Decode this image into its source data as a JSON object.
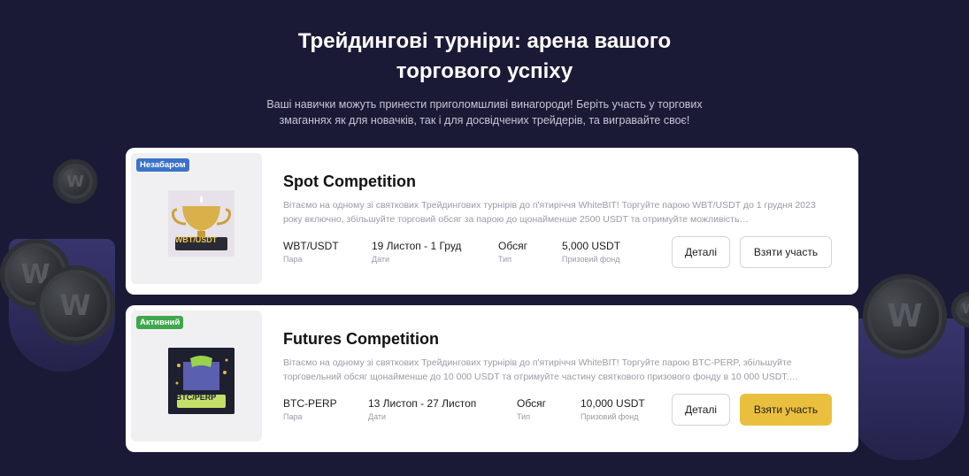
{
  "hero": {
    "title": "Трейдингові турніри: арена вашого торгового успіху",
    "subtitle": "Ваші навички можуть принести приголомшливі винагороди! Беріть участь у торгових змаганнях як для новачків, так і для досвідчених трейдерів, та вигравайте своє!"
  },
  "competitions": [
    {
      "badge": "Незабаром",
      "badge_color": "#3b73c8",
      "thumb_label": "WBT/USDT",
      "title": "Spot Competition",
      "description": "Вітаємо на одному зі святкових Трейдингових турнірів до п'ятиріччя WhiteBIT! Торгуйте парою WBT/USDT до 1 грудня 2023 року включно, збільшуйте торговий обсяг за парою до щонайменше 2500 USDT та отримуйте можливість…",
      "pair": "WBT/USDT",
      "pair_label": "Пара",
      "dates": "19 Листоп - 1 Груд",
      "dates_label": "Дати",
      "type": "Обсяг",
      "type_label": "Тип",
      "prize": "5,000 USDT",
      "prize_label": "Призовий фонд",
      "details_label": "Деталі",
      "join_label": "Взяти участь",
      "join_style": "outline"
    },
    {
      "badge": "Активний",
      "badge_color": "#3fa64c",
      "thumb_label": "BTC/PERP",
      "title": "Futures Competition",
      "description": "Вітаємо на одному зі святкових Трейдингових турнірів до п'ятиріччя WhiteBIT! Торгуйте парою BTC-PERP, збільшуйте торговельний обсяг щонайменше до 10 000 USDT та отримуйте частину святкового призового фонду в 10 000 USDT.…",
      "pair": "BTC-PERP",
      "pair_label": "Пара",
      "dates": "13 Листоп - 27 Листоп",
      "dates_label": "Дати",
      "type": "Обсяг",
      "type_label": "Тип",
      "prize": "10,000 USDT",
      "prize_label": "Призовий фонд",
      "details_label": "Деталі",
      "join_label": "Взяти участь",
      "join_style": "primary"
    }
  ],
  "colors": {
    "background": "#1b1a36",
    "accent": "#ebbf3e"
  }
}
